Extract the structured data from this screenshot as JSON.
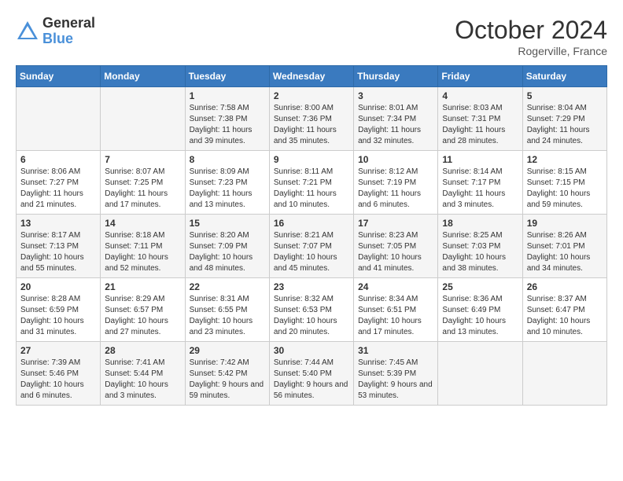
{
  "header": {
    "logo_general": "General",
    "logo_blue": "Blue",
    "month_title": "October 2024",
    "location": "Rogerville, France"
  },
  "days_of_week": [
    "Sunday",
    "Monday",
    "Tuesday",
    "Wednesday",
    "Thursday",
    "Friday",
    "Saturday"
  ],
  "weeks": [
    [
      {
        "day": "",
        "info": ""
      },
      {
        "day": "",
        "info": ""
      },
      {
        "day": "1",
        "info": "Sunrise: 7:58 AM\nSunset: 7:38 PM\nDaylight: 11 hours and 39 minutes."
      },
      {
        "day": "2",
        "info": "Sunrise: 8:00 AM\nSunset: 7:36 PM\nDaylight: 11 hours and 35 minutes."
      },
      {
        "day": "3",
        "info": "Sunrise: 8:01 AM\nSunset: 7:34 PM\nDaylight: 11 hours and 32 minutes."
      },
      {
        "day": "4",
        "info": "Sunrise: 8:03 AM\nSunset: 7:31 PM\nDaylight: 11 hours and 28 minutes."
      },
      {
        "day": "5",
        "info": "Sunrise: 8:04 AM\nSunset: 7:29 PM\nDaylight: 11 hours and 24 minutes."
      }
    ],
    [
      {
        "day": "6",
        "info": "Sunrise: 8:06 AM\nSunset: 7:27 PM\nDaylight: 11 hours and 21 minutes."
      },
      {
        "day": "7",
        "info": "Sunrise: 8:07 AM\nSunset: 7:25 PM\nDaylight: 11 hours and 17 minutes."
      },
      {
        "day": "8",
        "info": "Sunrise: 8:09 AM\nSunset: 7:23 PM\nDaylight: 11 hours and 13 minutes."
      },
      {
        "day": "9",
        "info": "Sunrise: 8:11 AM\nSunset: 7:21 PM\nDaylight: 11 hours and 10 minutes."
      },
      {
        "day": "10",
        "info": "Sunrise: 8:12 AM\nSunset: 7:19 PM\nDaylight: 11 hours and 6 minutes."
      },
      {
        "day": "11",
        "info": "Sunrise: 8:14 AM\nSunset: 7:17 PM\nDaylight: 11 hours and 3 minutes."
      },
      {
        "day": "12",
        "info": "Sunrise: 8:15 AM\nSunset: 7:15 PM\nDaylight: 10 hours and 59 minutes."
      }
    ],
    [
      {
        "day": "13",
        "info": "Sunrise: 8:17 AM\nSunset: 7:13 PM\nDaylight: 10 hours and 55 minutes."
      },
      {
        "day": "14",
        "info": "Sunrise: 8:18 AM\nSunset: 7:11 PM\nDaylight: 10 hours and 52 minutes."
      },
      {
        "day": "15",
        "info": "Sunrise: 8:20 AM\nSunset: 7:09 PM\nDaylight: 10 hours and 48 minutes."
      },
      {
        "day": "16",
        "info": "Sunrise: 8:21 AM\nSunset: 7:07 PM\nDaylight: 10 hours and 45 minutes."
      },
      {
        "day": "17",
        "info": "Sunrise: 8:23 AM\nSunset: 7:05 PM\nDaylight: 10 hours and 41 minutes."
      },
      {
        "day": "18",
        "info": "Sunrise: 8:25 AM\nSunset: 7:03 PM\nDaylight: 10 hours and 38 minutes."
      },
      {
        "day": "19",
        "info": "Sunrise: 8:26 AM\nSunset: 7:01 PM\nDaylight: 10 hours and 34 minutes."
      }
    ],
    [
      {
        "day": "20",
        "info": "Sunrise: 8:28 AM\nSunset: 6:59 PM\nDaylight: 10 hours and 31 minutes."
      },
      {
        "day": "21",
        "info": "Sunrise: 8:29 AM\nSunset: 6:57 PM\nDaylight: 10 hours and 27 minutes."
      },
      {
        "day": "22",
        "info": "Sunrise: 8:31 AM\nSunset: 6:55 PM\nDaylight: 10 hours and 23 minutes."
      },
      {
        "day": "23",
        "info": "Sunrise: 8:32 AM\nSunset: 6:53 PM\nDaylight: 10 hours and 20 minutes."
      },
      {
        "day": "24",
        "info": "Sunrise: 8:34 AM\nSunset: 6:51 PM\nDaylight: 10 hours and 17 minutes."
      },
      {
        "day": "25",
        "info": "Sunrise: 8:36 AM\nSunset: 6:49 PM\nDaylight: 10 hours and 13 minutes."
      },
      {
        "day": "26",
        "info": "Sunrise: 8:37 AM\nSunset: 6:47 PM\nDaylight: 10 hours and 10 minutes."
      }
    ],
    [
      {
        "day": "27",
        "info": "Sunrise: 7:39 AM\nSunset: 5:46 PM\nDaylight: 10 hours and 6 minutes."
      },
      {
        "day": "28",
        "info": "Sunrise: 7:41 AM\nSunset: 5:44 PM\nDaylight: 10 hours and 3 minutes."
      },
      {
        "day": "29",
        "info": "Sunrise: 7:42 AM\nSunset: 5:42 PM\nDaylight: 9 hours and 59 minutes."
      },
      {
        "day": "30",
        "info": "Sunrise: 7:44 AM\nSunset: 5:40 PM\nDaylight: 9 hours and 56 minutes."
      },
      {
        "day": "31",
        "info": "Sunrise: 7:45 AM\nSunset: 5:39 PM\nDaylight: 9 hours and 53 minutes."
      },
      {
        "day": "",
        "info": ""
      },
      {
        "day": "",
        "info": ""
      }
    ]
  ]
}
